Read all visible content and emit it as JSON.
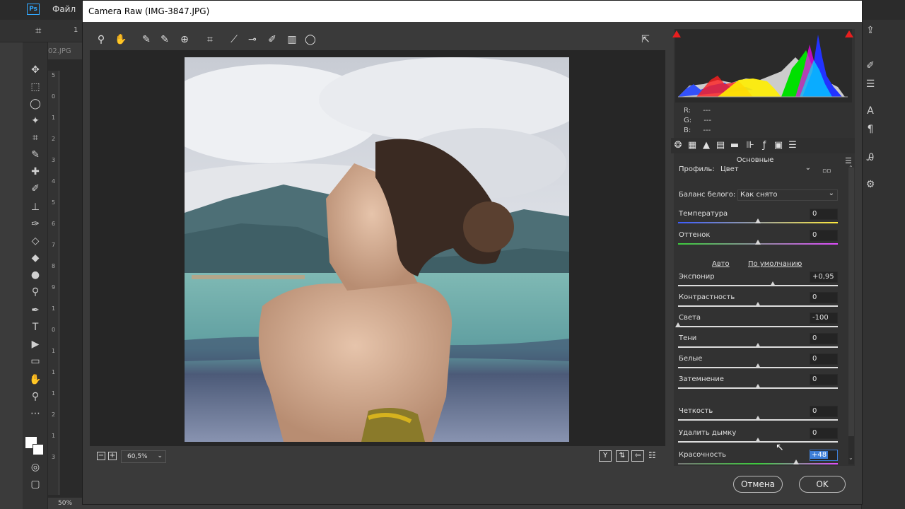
{
  "photoshop": {
    "logo": "Ps",
    "menu_file": "Файл",
    "option_number": "1",
    "doc_tab": "02.JPG",
    "ruler_marks": [
      "5",
      "0",
      "1",
      "2",
      "3",
      "4",
      "5",
      "6",
      "7",
      "8",
      "9",
      "1",
      "0",
      "1",
      "1",
      "1",
      "2",
      "1",
      "3"
    ],
    "zoom_status": "50%"
  },
  "camera_raw": {
    "title": "Camera Raw (IMG-3847.JPG)",
    "zoom_value": "60,5%",
    "rgb": {
      "r_label": "R:",
      "g_label": "G:",
      "b_label": "B:",
      "r": "---",
      "g": "---",
      "b": "---"
    },
    "section_title": "Основные",
    "profile_label": "Профиль:",
    "profile_value": "Цвет",
    "wb_label": "Баланс белого:",
    "wb_value": "Как снято",
    "auto_link": "Авто",
    "default_link": "По умолчанию",
    "sliders": [
      {
        "label": "Температура",
        "value": "0",
        "pos": 0.5
      },
      {
        "label": "Оттенок",
        "value": "0",
        "pos": 0.5
      },
      {
        "label": "Экспонир",
        "value": "+0,95",
        "pos": 0.595
      },
      {
        "label": "Контрастность",
        "value": "0",
        "pos": 0.5
      },
      {
        "label": "Света",
        "value": "-100",
        "pos": 0.0
      },
      {
        "label": "Тени",
        "value": "0",
        "pos": 0.5
      },
      {
        "label": "Белые",
        "value": "0",
        "pos": 0.5
      },
      {
        "label": "Затемнение",
        "value": "0",
        "pos": 0.5
      },
      {
        "label": "Четкость",
        "value": "0",
        "pos": 0.5
      },
      {
        "label": "Удалить дымку",
        "value": "0",
        "pos": 0.5
      },
      {
        "label": "Красочность",
        "value": "+48",
        "pos": 0.74
      }
    ],
    "cancel_label": "Отмена",
    "ok_label": "OK"
  },
  "colors": {
    "accent": "#31a8ff",
    "selection": "#3d7ed8",
    "clip_warning": "#e81e1e"
  }
}
